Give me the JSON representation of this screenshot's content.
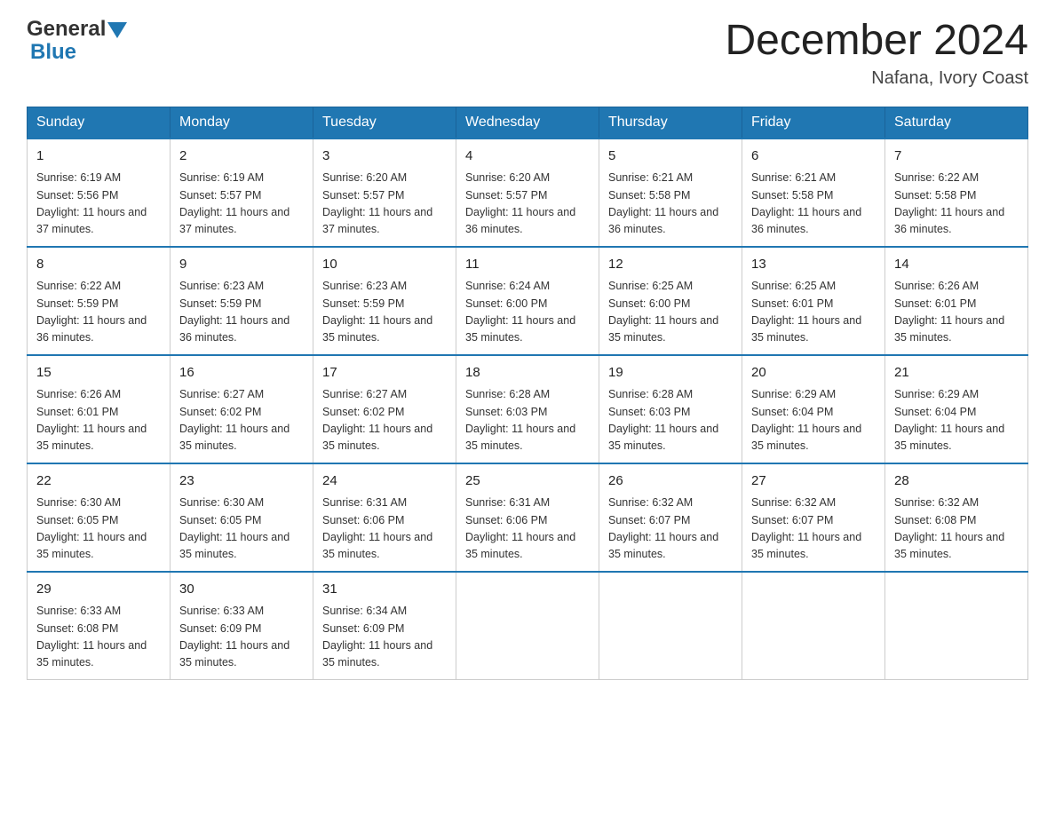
{
  "header": {
    "logo": {
      "general": "General",
      "blue": "Blue",
      "alt": "GeneralBlue logo"
    },
    "title": "December 2024",
    "location": "Nafana, Ivory Coast"
  },
  "calendar": {
    "days": [
      "Sunday",
      "Monday",
      "Tuesday",
      "Wednesday",
      "Thursday",
      "Friday",
      "Saturday"
    ],
    "weeks": [
      [
        {
          "date": "1",
          "sunrise": "6:19 AM",
          "sunset": "5:56 PM",
          "daylight": "11 hours and 37 minutes."
        },
        {
          "date": "2",
          "sunrise": "6:19 AM",
          "sunset": "5:57 PM",
          "daylight": "11 hours and 37 minutes."
        },
        {
          "date": "3",
          "sunrise": "6:20 AM",
          "sunset": "5:57 PM",
          "daylight": "11 hours and 37 minutes."
        },
        {
          "date": "4",
          "sunrise": "6:20 AM",
          "sunset": "5:57 PM",
          "daylight": "11 hours and 36 minutes."
        },
        {
          "date": "5",
          "sunrise": "6:21 AM",
          "sunset": "5:58 PM",
          "daylight": "11 hours and 36 minutes."
        },
        {
          "date": "6",
          "sunrise": "6:21 AM",
          "sunset": "5:58 PM",
          "daylight": "11 hours and 36 minutes."
        },
        {
          "date": "7",
          "sunrise": "6:22 AM",
          "sunset": "5:58 PM",
          "daylight": "11 hours and 36 minutes."
        }
      ],
      [
        {
          "date": "8",
          "sunrise": "6:22 AM",
          "sunset": "5:59 PM",
          "daylight": "11 hours and 36 minutes."
        },
        {
          "date": "9",
          "sunrise": "6:23 AM",
          "sunset": "5:59 PM",
          "daylight": "11 hours and 36 minutes."
        },
        {
          "date": "10",
          "sunrise": "6:23 AM",
          "sunset": "5:59 PM",
          "daylight": "11 hours and 35 minutes."
        },
        {
          "date": "11",
          "sunrise": "6:24 AM",
          "sunset": "6:00 PM",
          "daylight": "11 hours and 35 minutes."
        },
        {
          "date": "12",
          "sunrise": "6:25 AM",
          "sunset": "6:00 PM",
          "daylight": "11 hours and 35 minutes."
        },
        {
          "date": "13",
          "sunrise": "6:25 AM",
          "sunset": "6:01 PM",
          "daylight": "11 hours and 35 minutes."
        },
        {
          "date": "14",
          "sunrise": "6:26 AM",
          "sunset": "6:01 PM",
          "daylight": "11 hours and 35 minutes."
        }
      ],
      [
        {
          "date": "15",
          "sunrise": "6:26 AM",
          "sunset": "6:01 PM",
          "daylight": "11 hours and 35 minutes."
        },
        {
          "date": "16",
          "sunrise": "6:27 AM",
          "sunset": "6:02 PM",
          "daylight": "11 hours and 35 minutes."
        },
        {
          "date": "17",
          "sunrise": "6:27 AM",
          "sunset": "6:02 PM",
          "daylight": "11 hours and 35 minutes."
        },
        {
          "date": "18",
          "sunrise": "6:28 AM",
          "sunset": "6:03 PM",
          "daylight": "11 hours and 35 minutes."
        },
        {
          "date": "19",
          "sunrise": "6:28 AM",
          "sunset": "6:03 PM",
          "daylight": "11 hours and 35 minutes."
        },
        {
          "date": "20",
          "sunrise": "6:29 AM",
          "sunset": "6:04 PM",
          "daylight": "11 hours and 35 minutes."
        },
        {
          "date": "21",
          "sunrise": "6:29 AM",
          "sunset": "6:04 PM",
          "daylight": "11 hours and 35 minutes."
        }
      ],
      [
        {
          "date": "22",
          "sunrise": "6:30 AM",
          "sunset": "6:05 PM",
          "daylight": "11 hours and 35 minutes."
        },
        {
          "date": "23",
          "sunrise": "6:30 AM",
          "sunset": "6:05 PM",
          "daylight": "11 hours and 35 minutes."
        },
        {
          "date": "24",
          "sunrise": "6:31 AM",
          "sunset": "6:06 PM",
          "daylight": "11 hours and 35 minutes."
        },
        {
          "date": "25",
          "sunrise": "6:31 AM",
          "sunset": "6:06 PM",
          "daylight": "11 hours and 35 minutes."
        },
        {
          "date": "26",
          "sunrise": "6:32 AM",
          "sunset": "6:07 PM",
          "daylight": "11 hours and 35 minutes."
        },
        {
          "date": "27",
          "sunrise": "6:32 AM",
          "sunset": "6:07 PM",
          "daylight": "11 hours and 35 minutes."
        },
        {
          "date": "28",
          "sunrise": "6:32 AM",
          "sunset": "6:08 PM",
          "daylight": "11 hours and 35 minutes."
        }
      ],
      [
        {
          "date": "29",
          "sunrise": "6:33 AM",
          "sunset": "6:08 PM",
          "daylight": "11 hours and 35 minutes."
        },
        {
          "date": "30",
          "sunrise": "6:33 AM",
          "sunset": "6:09 PM",
          "daylight": "11 hours and 35 minutes."
        },
        {
          "date": "31",
          "sunrise": "6:34 AM",
          "sunset": "6:09 PM",
          "daylight": "11 hours and 35 minutes."
        },
        null,
        null,
        null,
        null
      ]
    ]
  }
}
